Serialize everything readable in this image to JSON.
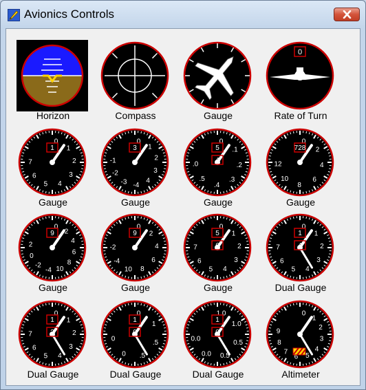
{
  "window": {
    "title": "Avionics Controls"
  },
  "instruments": [
    {
      "label": "Horizon",
      "type": "horizon"
    },
    {
      "label": "Compass",
      "type": "compass"
    },
    {
      "label": "Gauge",
      "type": "plane"
    },
    {
      "label": "Rate of Turn",
      "type": "turn",
      "readout": "0"
    },
    {
      "label": "Gauge",
      "type": "dial",
      "ticks": [
        "0",
        "1",
        "2",
        "3",
        "4",
        "5",
        "6",
        "7"
      ],
      "boxes": [
        "1"
      ]
    },
    {
      "label": "Gauge",
      "type": "dial",
      "ticks": [
        "0",
        "1",
        "2",
        "3",
        "4",
        "-4",
        "-3",
        "-2",
        "-1"
      ],
      "boxes": [
        "3"
      ]
    },
    {
      "label": "Gauge",
      "type": "dial",
      "ticks": [
        "0",
        ".1",
        ".2",
        ".3",
        ".4",
        ".5",
        ".0"
      ],
      "boxes": [
        "5",
        "4"
      ]
    },
    {
      "label": "Gauge",
      "type": "dial",
      "ticks": [
        "0",
        "2",
        "4",
        "6",
        "8",
        "10",
        "12"
      ],
      "boxes": [
        "728"
      ]
    },
    {
      "label": "Gauge",
      "type": "dial",
      "ticks": [
        "0",
        "2",
        "4",
        "6",
        "8",
        "10",
        "-4",
        "-2",
        "0",
        "2"
      ],
      "boxes": [
        "9"
      ]
    },
    {
      "label": "Gauge",
      "type": "dial",
      "ticks": [
        "0",
        "2",
        "4",
        "6",
        "8",
        "10",
        "-4",
        "-2"
      ],
      "boxes": [
        "9"
      ]
    },
    {
      "label": "Gauge",
      "type": "dial",
      "ticks": [
        "0",
        "1",
        "2",
        "3",
        "4",
        "5",
        "6",
        "7"
      ],
      "boxes": [
        "5",
        "6"
      ]
    },
    {
      "label": "Dual Gauge",
      "type": "dial",
      "ticks": [
        "0",
        "1",
        "2",
        "3",
        "4",
        "5",
        "6",
        "7"
      ],
      "boxes": [
        "1",
        "4"
      ]
    },
    {
      "label": "Dual Gauge",
      "type": "dial",
      "ticks": [
        "0",
        "1",
        "2",
        "3",
        "4",
        "5",
        "6",
        "7"
      ],
      "boxes": [
        "1",
        "2"
      ]
    },
    {
      "label": "Dual Gauge",
      "type": "dial",
      "ticks": [
        "0",
        "1",
        ".5",
        ".5",
        "0",
        "0"
      ],
      "boxes": [
        "1",
        "0"
      ]
    },
    {
      "label": "Dual Gauge",
      "type": "dial",
      "ticks": [
        "1.0",
        "1.0",
        "0.5",
        "0.5",
        "0.0",
        "0.0"
      ],
      "boxes": [
        "1",
        "0"
      ]
    },
    {
      "label": "Altimeter",
      "type": "dial",
      "ticks": [
        "0",
        "1",
        "2",
        "3",
        "4",
        "5",
        "6",
        "7",
        "8",
        "9"
      ],
      "boxes": []
    }
  ],
  "colors": {
    "bezel": "#cc0000",
    "face": "#000000",
    "sky": "#1a1aff",
    "ground": "#8a6a1a"
  }
}
